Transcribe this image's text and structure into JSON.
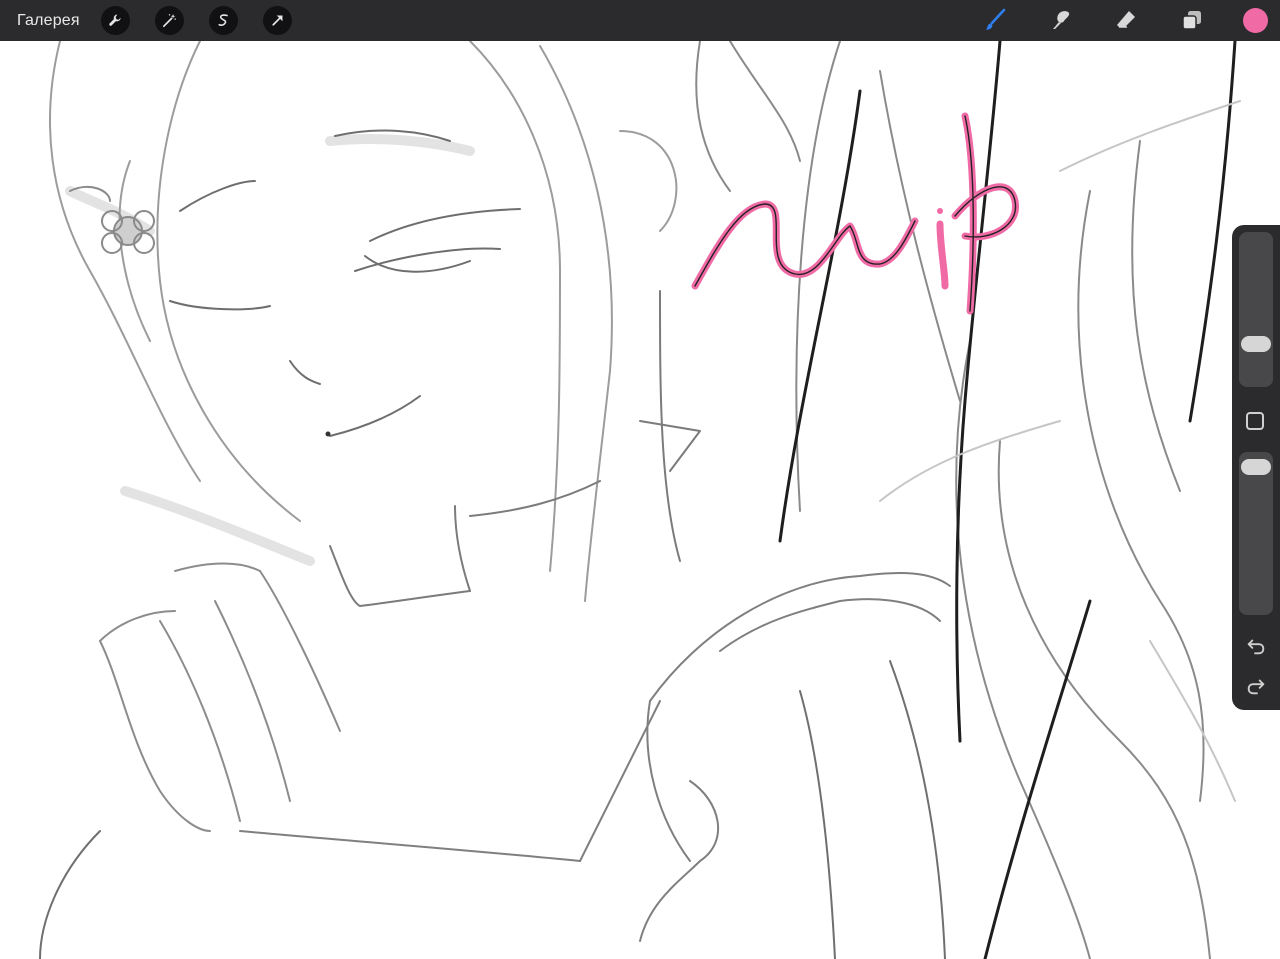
{
  "topbar": {
    "gallery_label": "Галерея",
    "left_tools": [
      "wrench-icon",
      "magic-wand-icon",
      "selection-s-icon",
      "transform-arrow-icon"
    ],
    "right_tools": [
      "brush-icon",
      "smudge-icon",
      "eraser-icon",
      "layers-icon"
    ],
    "active_tool": "brush-icon",
    "current_color": "#f06aa6",
    "active_color": "#2f7ff0"
  },
  "canvas": {
    "handwriting": "wip",
    "handwriting_color": "#f06aa6"
  },
  "sidebar": {
    "brush_size_level": 0.25,
    "opacity_level": 0.95
  }
}
